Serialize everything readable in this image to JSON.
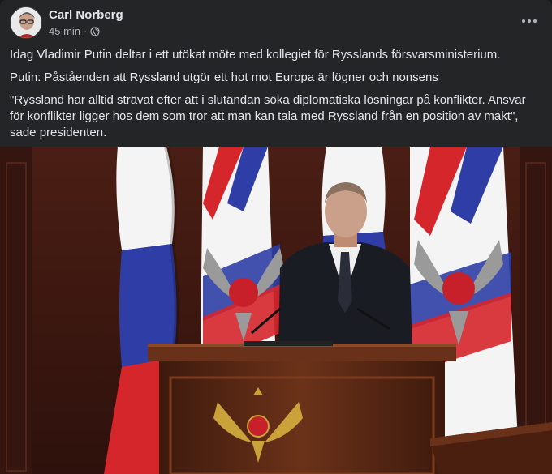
{
  "post": {
    "author": "Carl Norberg",
    "time": "45 min",
    "separator": "·",
    "privacy_icon": "globe-icon",
    "menu_icon": "more-dots-icon",
    "paragraphs": [
      "Idag Vladimir Putin deltar i ett utökat möte med kollegiet för Rysslands försvarsministerium.",
      "Putin: Påståenden att Ryssland utgör ett hot mot Europa är lögner och nonsens",
      "\"Ryssland har alltid strävat efter att i slutändan söka diplomatiska lösningar på konflikter. Ansvar för konflikter ligger hos dem som tror att man kan tala med Ryssland från en position av makt\", sade presidenten."
    ]
  },
  "colors": {
    "background": "#242526",
    "text": "#e4e6eb",
    "secondary_text": "#b0b3b8",
    "flag_white": "#f4f4f4",
    "flag_blue": "#2f3ea6",
    "flag_red": "#d5262c",
    "wall": "#3b1711",
    "podium": "#5e2a16"
  }
}
